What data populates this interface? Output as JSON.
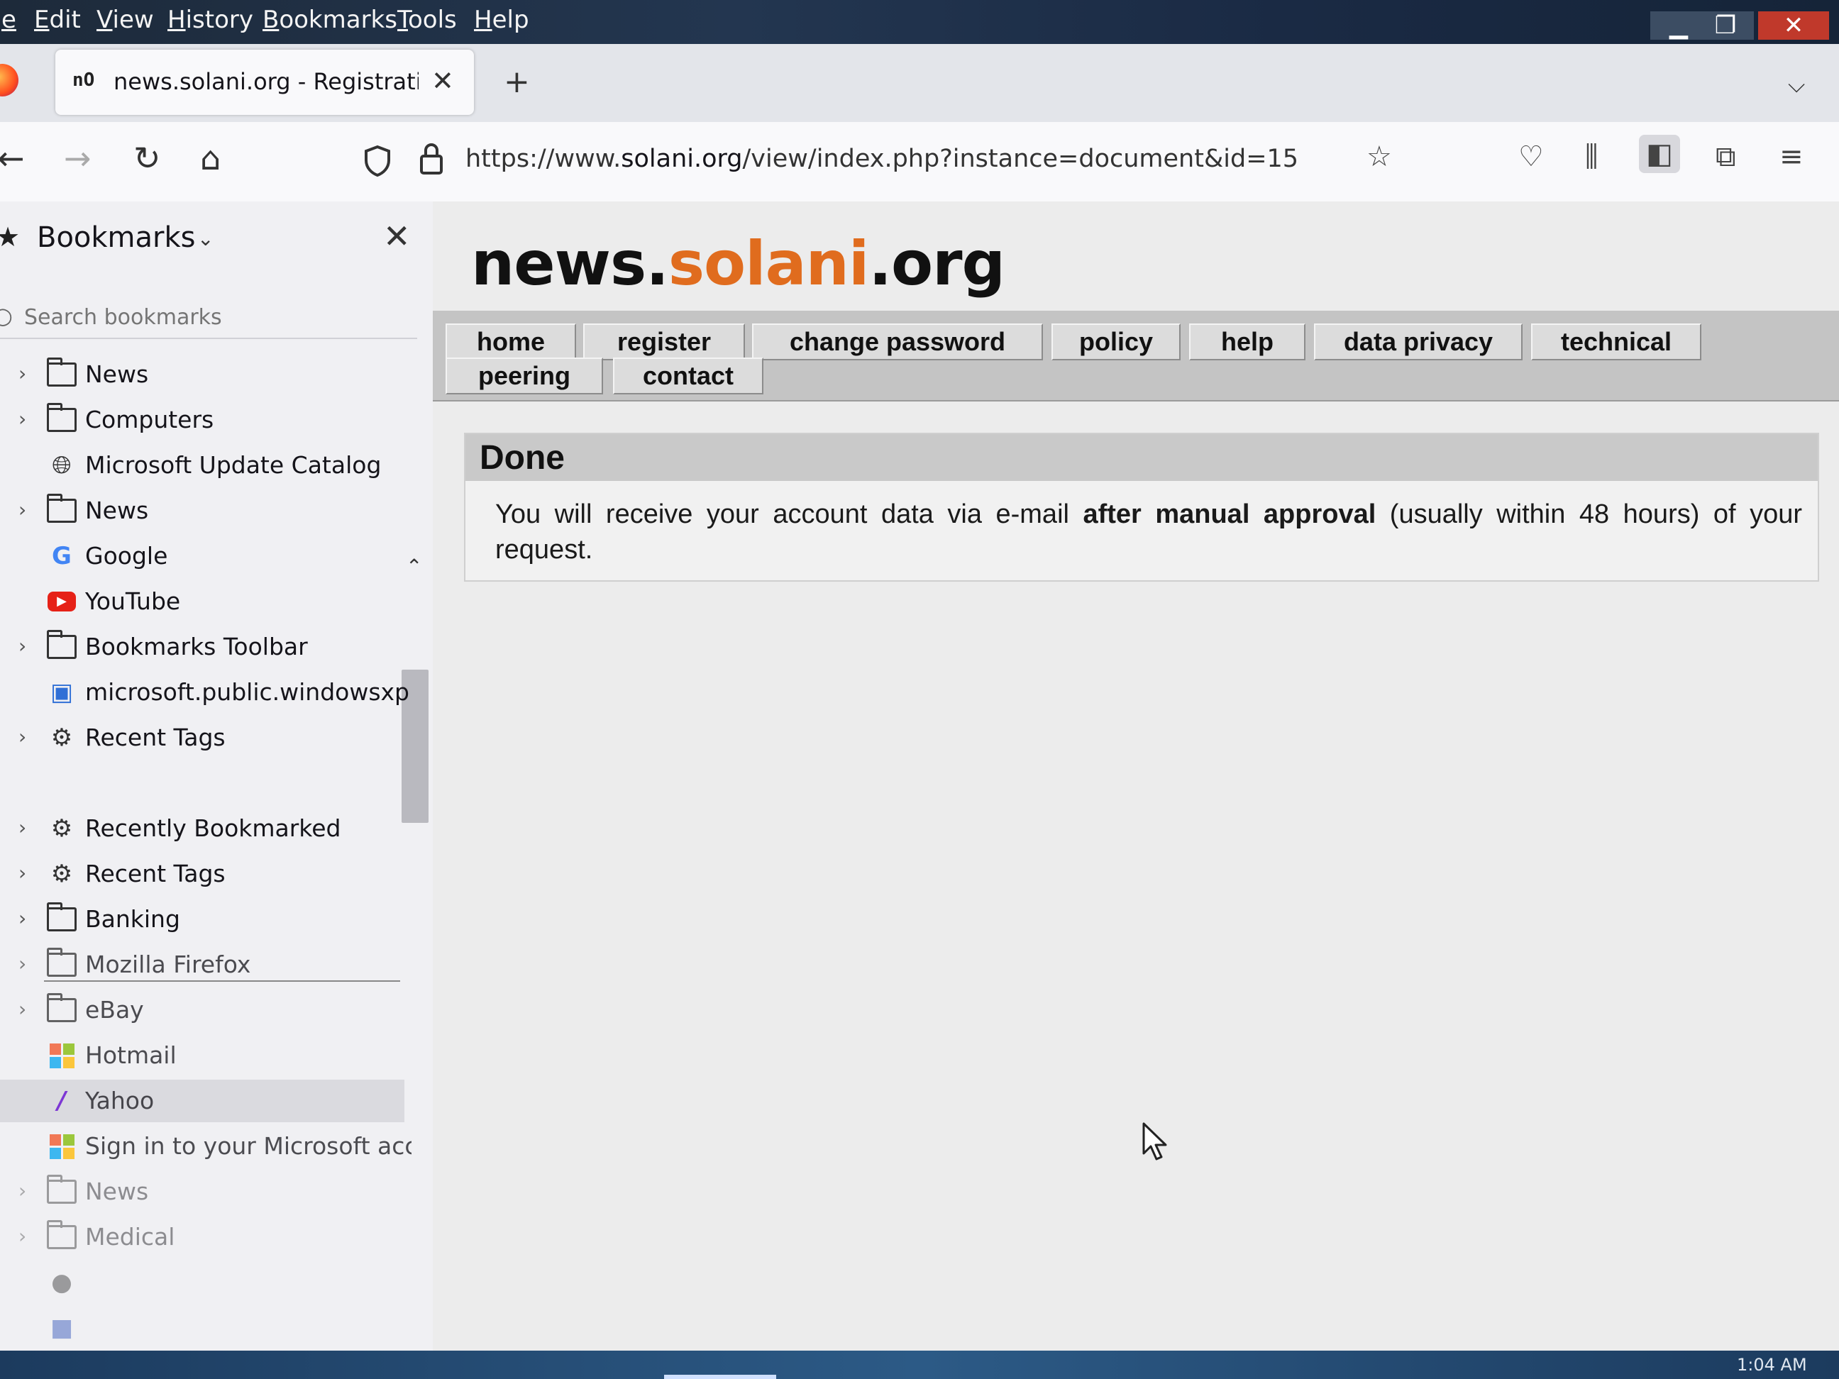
{
  "menubar": {
    "items": [
      "e",
      "Edit",
      "View",
      "History",
      "Bookmarks",
      "Tools",
      "Help"
    ]
  },
  "tab": {
    "favicon": "nO",
    "title": "news.solani.org - Registration c"
  },
  "navbar": {
    "url": "https://www.solani.org/view/index.php?instance=document&id=15",
    "url_prefix": "https://www.",
    "url_domain": "solani.org",
    "url_path": "/view/index.php?instance=document&id=15"
  },
  "sidebar": {
    "title": "Bookmarks",
    "search_placeholder": "Search bookmarks",
    "items": [
      {
        "label": "News",
        "icon": "folder-icon",
        "twisty": true
      },
      {
        "label": "Computers",
        "icon": "folder-icon",
        "twisty": true
      },
      {
        "label": "Microsoft Update Catalog",
        "icon": "globe-icon",
        "twisty": false
      },
      {
        "label": "News",
        "icon": "folder-icon",
        "twisty": true
      },
      {
        "label": "Google",
        "icon": "google-icon",
        "twisty": false
      },
      {
        "label": "YouTube",
        "icon": "youtube-icon",
        "twisty": false
      },
      {
        "label": "Bookmarks Toolbar",
        "icon": "folder-icon",
        "twisty": true
      },
      {
        "label": "microsoft.public.windowsxp.ge",
        "icon": "newsgroup-icon",
        "twisty": false
      },
      {
        "label": "Recent Tags",
        "icon": "gear-icon",
        "twisty": true
      },
      {
        "label": "Recently Bookmarked",
        "icon": "gear-icon",
        "twisty": true
      },
      {
        "label": "Recent Tags",
        "icon": "gear-icon",
        "twisty": true
      },
      {
        "label": "Banking",
        "icon": "folder-icon",
        "twisty": true
      },
      {
        "label": "Mozilla Firefox",
        "icon": "folder-icon",
        "twisty": true
      },
      {
        "label": "eBay",
        "icon": "folder-icon",
        "twisty": true
      },
      {
        "label": "Hotmail",
        "icon": "microsoft-icon",
        "twisty": false
      },
      {
        "label": "Yahoo",
        "icon": "yahoo-icon",
        "twisty": false
      },
      {
        "label": "Sign in to your Microsoft accou",
        "icon": "microsoft-icon",
        "twisty": false
      },
      {
        "label": "News",
        "icon": "folder-icon",
        "twisty": true
      },
      {
        "label": "Medical",
        "icon": "folder-icon",
        "twisty": true
      }
    ]
  },
  "page": {
    "logo_left": "news.",
    "logo_mid": "solani",
    "logo_right": ".org",
    "nav_links": [
      "home",
      "register",
      "change password",
      "policy",
      "help",
      "data privacy",
      "technical",
      "peering",
      "contact"
    ],
    "message_title": "Done",
    "message_text_1": "You will receive your account data via e-mail ",
    "message_text_bold": "after manual approval",
    "message_text_2": " (usually within 48 hours) of your request."
  },
  "colors": {
    "logo_accent": "#e06c1e",
    "nav_bg": "#c4c4c4",
    "message_header_bg": "#c9c9c9"
  },
  "taskbar": {
    "clock": "1:04 AM"
  }
}
